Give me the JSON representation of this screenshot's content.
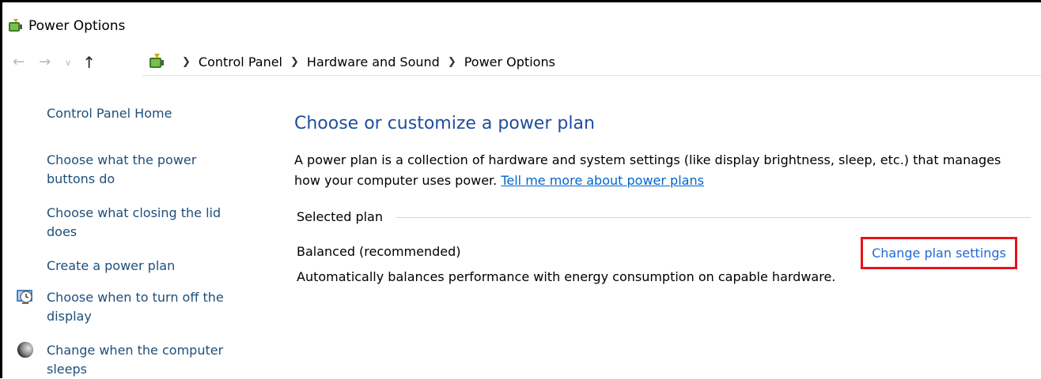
{
  "window": {
    "title": "Power Options",
    "icon": "power-options-icon"
  },
  "navigation": {
    "back_icon": "arrow-left-icon",
    "forward_icon": "arrow-right-icon",
    "recent_icon": "chevron-down-icon",
    "up_icon": "arrow-up-icon",
    "breadcrumb": [
      "Control Panel",
      "Hardware and Sound",
      "Power Options"
    ]
  },
  "sidebar": {
    "home": "Control Panel Home",
    "items": [
      {
        "label_line1": "Choose what the power",
        "label_line2": "buttons do",
        "icon": ""
      },
      {
        "label_line1": "Choose what closing the lid",
        "label_line2": "does",
        "icon": ""
      },
      {
        "label_line1": "Create a power plan",
        "label_line2": "",
        "icon": ""
      },
      {
        "label_line1": "Choose when to turn off the",
        "label_line2": "display",
        "icon": "display-clock-icon"
      },
      {
        "label_line1": "Change when the computer",
        "label_line2": "sleeps",
        "icon": "moon-icon"
      }
    ]
  },
  "main": {
    "title": "Choose or customize a power plan",
    "description_line1": "A power plan is a collection of hardware and system settings (like display brightness, sleep, etc.) that manages",
    "description_line2": "how your computer uses power.",
    "learn_more_link": "Tell me more about power plans",
    "selected_plan_label": "Selected plan",
    "plan_name": "Balanced (recommended)",
    "plan_description": "Automatically balances performance with energy consumption on capable hardware.",
    "change_settings_link": "Change plan settings"
  },
  "colors": {
    "title_blue": "#1f4e9c",
    "link_blue": "#0066cc",
    "highlight_red": "#e8141c"
  }
}
